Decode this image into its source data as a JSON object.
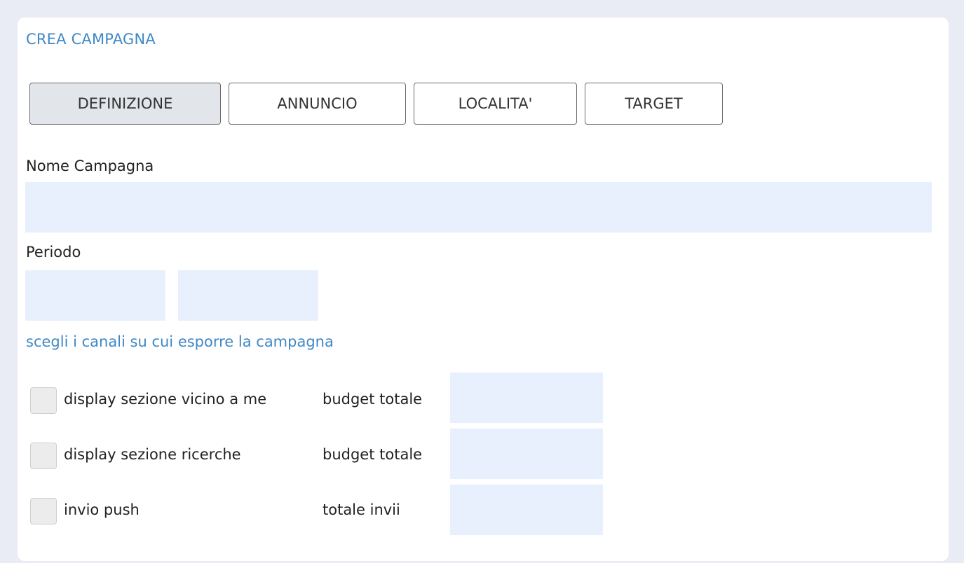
{
  "page": {
    "title": "CREA CAMPAGNA"
  },
  "tabs": [
    {
      "label": "DEFINIZIONE",
      "active": true
    },
    {
      "label": "ANNUNCIO",
      "active": false
    },
    {
      "label": "LOCALITA'",
      "active": false
    },
    {
      "label": "TARGET",
      "active": false
    }
  ],
  "form": {
    "campaign_name_label": "Nome Campagna",
    "campaign_name_value": "",
    "period_label": "Periodo",
    "period_start_value": "",
    "period_end_value": ""
  },
  "channels": {
    "heading": "scegli i canali su cui esporre la campagna",
    "items": [
      {
        "label": "display sezione vicino a me",
        "checked": false,
        "amount_label": "budget totale",
        "amount_value": ""
      },
      {
        "label": "display sezione ricerche",
        "checked": false,
        "amount_label": "budget totale",
        "amount_value": ""
      },
      {
        "label": "invio push",
        "checked": false,
        "amount_label": "totale invii",
        "amount_value": ""
      }
    ]
  },
  "colors": {
    "page_background": "#e9ebf5",
    "card_background": "#ffffff",
    "accent": "#3f88c5",
    "input_background": "#e8f0fd",
    "active_tab_background": "#e2e6ea"
  }
}
